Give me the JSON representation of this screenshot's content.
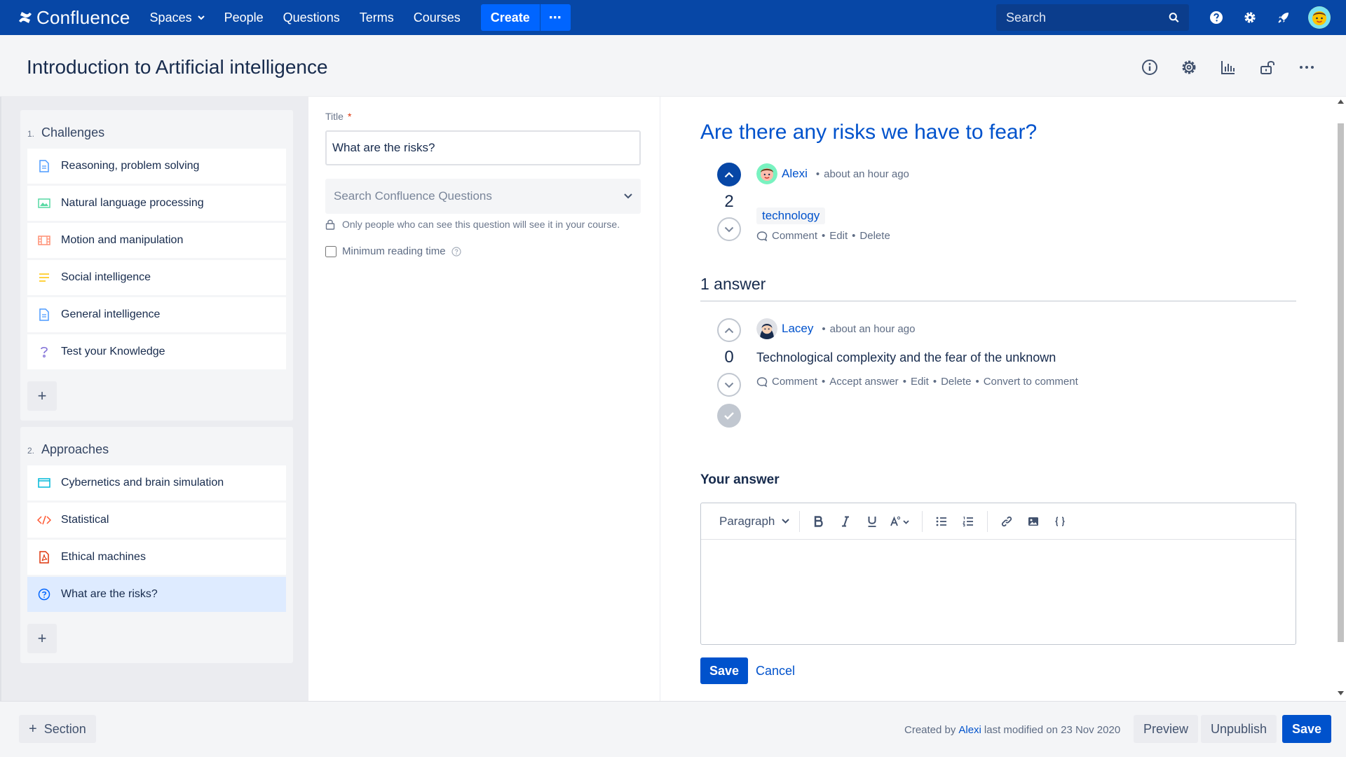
{
  "topnav": {
    "brand": "Confluence",
    "spaces": "Spaces",
    "people": "People",
    "questions": "Questions",
    "terms": "Terms",
    "courses": "Courses",
    "create": "Create",
    "more": "⋯",
    "search_placeholder": "Search",
    "icons": [
      "help-icon",
      "settings-icon",
      "notifications-icon"
    ]
  },
  "page": {
    "title": "Introduction to Artificial intelligence",
    "header_icons": [
      "info-icon",
      "gear-icon",
      "analytics-icon",
      "unlock-icon",
      "more-icon"
    ]
  },
  "sections": [
    {
      "num": "1.",
      "name": "Challenges",
      "items": [
        {
          "label": "Reasoning, problem solving",
          "icon": "page-icon"
        },
        {
          "label": "Natural language processing",
          "icon": "image-icon"
        },
        {
          "label": "Motion and manipulation",
          "icon": "video-icon"
        },
        {
          "label": "Social intelligence",
          "icon": "text-icon"
        },
        {
          "label": "General intelligence",
          "icon": "page-icon"
        },
        {
          "label": "Test your Knowledge",
          "icon": "quiz-icon"
        }
      ],
      "add": "+"
    },
    {
      "num": "2.",
      "name": "Approaches",
      "items": [
        {
          "label": "Cybernetics and brain simulation",
          "icon": "window-icon"
        },
        {
          "label": "Statistical",
          "icon": "code-icon"
        },
        {
          "label": "Ethical machines",
          "icon": "pdf-icon"
        },
        {
          "label": "What are the risks?",
          "icon": "question-icon"
        }
      ],
      "add": "+"
    }
  ],
  "form": {
    "title_label": "Title",
    "required_mark": "*",
    "title_value": "What are the risks?",
    "search_placeholder": "Search Confluence Questions",
    "notice": "Only people who can see this question will see it in your course.",
    "min_reading": "Minimum reading time"
  },
  "question": {
    "title": "Are there any risks we have to fear?",
    "author": "Alexi",
    "time": "about an hour ago",
    "votes": "2",
    "tag": "technology",
    "actions": [
      "Comment",
      "Edit",
      "Delete"
    ]
  },
  "answers_heading": "1 answer",
  "answer": {
    "author": "Lacey",
    "time": "about an hour ago",
    "votes": "0",
    "text": "Technological complexity and the fear of the unknown",
    "actions": [
      "Comment",
      "Accept answer",
      "Edit",
      "Delete",
      "Convert to comment"
    ]
  },
  "your_answer": {
    "heading": "Your answer",
    "paragraph": "Paragraph",
    "save": "Save",
    "cancel": "Cancel"
  },
  "footer": {
    "add_section": "Section",
    "created_prefix": "Created by",
    "created_by": "Alexi",
    "modified": "last modified on 23 Nov 2020",
    "preview": "Preview",
    "unpublish": "Unpublish",
    "save": "Save"
  },
  "colors": {
    "nav": "#0747a6",
    "primary": "#0052cc",
    "create": "#0065ff"
  }
}
